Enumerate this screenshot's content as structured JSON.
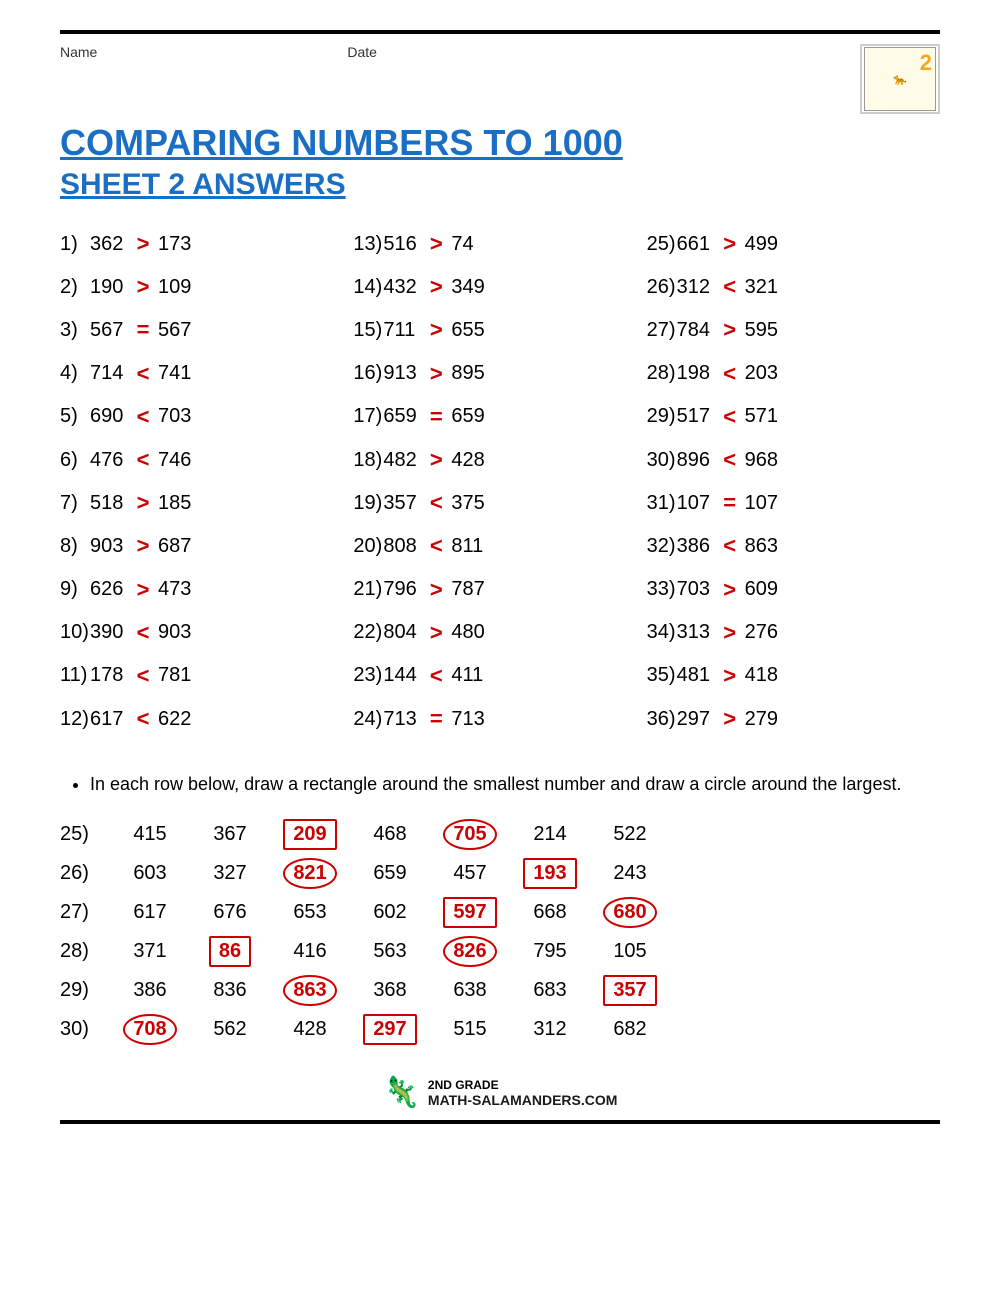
{
  "header": {
    "name_label": "Name",
    "date_label": "Date",
    "logo_num": "2"
  },
  "title": "COMPARING NUMBERS TO 1000",
  "subtitle": "SHEET 2 ANSWERS",
  "comparisons": {
    "col1": [
      {
        "num": "1)",
        "a": "362",
        "op": ">",
        "b": "173"
      },
      {
        "num": "2)",
        "a": "190",
        "op": ">",
        "b": "109"
      },
      {
        "num": "3)",
        "a": "567",
        "op": "=",
        "b": "567"
      },
      {
        "num": "4)",
        "a": "714",
        "op": "<",
        "b": "741"
      },
      {
        "num": "5)",
        "a": "690",
        "op": "<",
        "b": "703"
      },
      {
        "num": "6)",
        "a": "476",
        "op": "<",
        "b": "746"
      },
      {
        "num": "7)",
        "a": "518",
        "op": ">",
        "b": "185"
      },
      {
        "num": "8)",
        "a": "903",
        "op": ">",
        "b": "687"
      },
      {
        "num": "9)",
        "a": "626",
        "op": ">",
        "b": "473"
      },
      {
        "num": "10)",
        "a": "390",
        "op": "<",
        "b": "903"
      },
      {
        "num": "11)",
        "a": "178",
        "op": "<",
        "b": "781"
      },
      {
        "num": "12)",
        "a": "617",
        "op": "<",
        "b": "622"
      }
    ],
    "col2": [
      {
        "num": "13)",
        "a": "516",
        "op": ">",
        "b": "74"
      },
      {
        "num": "14)",
        "a": "432",
        "op": ">",
        "b": "349"
      },
      {
        "num": "15)",
        "a": "711",
        "op": ">",
        "b": "655"
      },
      {
        "num": "16)",
        "a": "913",
        "op": ">",
        "b": "895"
      },
      {
        "num": "17)",
        "a": "659",
        "op": "=",
        "b": "659"
      },
      {
        "num": "18)",
        "a": "482",
        "op": ">",
        "b": "428"
      },
      {
        "num": "19)",
        "a": "357",
        "op": "<",
        "b": "375"
      },
      {
        "num": "20)",
        "a": "808",
        "op": "<",
        "b": "811"
      },
      {
        "num": "21)",
        "a": "796",
        "op": ">",
        "b": "787"
      },
      {
        "num": "22)",
        "a": "804",
        "op": ">",
        "b": "480"
      },
      {
        "num": "23)",
        "a": "144",
        "op": "<",
        "b": "411"
      },
      {
        "num": "24)",
        "a": "713",
        "op": "=",
        "b": "713"
      }
    ],
    "col3": [
      {
        "num": "25)",
        "a": "661",
        "op": ">",
        "b": "499"
      },
      {
        "num": "26)",
        "a": "312",
        "op": "<",
        "b": "321"
      },
      {
        "num": "27)",
        "a": "784",
        "op": ">",
        "b": "595"
      },
      {
        "num": "28)",
        "a": "198",
        "op": "<",
        "b": "203"
      },
      {
        "num": "29)",
        "a": "517",
        "op": "<",
        "b": "571"
      },
      {
        "num": "30)",
        "a": "896",
        "op": "<",
        "b": "968"
      },
      {
        "num": "31)",
        "a": "107",
        "op": "=",
        "b": "107"
      },
      {
        "num": "32)",
        "a": "386",
        "op": "<",
        "b": "863"
      },
      {
        "num": "33)",
        "a": "703",
        "op": ">",
        "b": "609"
      },
      {
        "num": "34)",
        "a": "313",
        "op": ">",
        "b": "276"
      },
      {
        "num": "35)",
        "a": "481",
        "op": ">",
        "b": "418"
      },
      {
        "num": "36)",
        "a": "297",
        "op": ">",
        "b": "279"
      }
    ]
  },
  "bullet_text": "In each row below, draw a rectangle around the smallest number and draw a circle around the largest.",
  "number_rows": [
    {
      "label": "25)",
      "cells": [
        {
          "val": "415",
          "type": "plain"
        },
        {
          "val": "367",
          "type": "plain"
        },
        {
          "val": "209",
          "type": "rect"
        },
        {
          "val": "468",
          "type": "plain"
        },
        {
          "val": "705",
          "type": "circle"
        },
        {
          "val": "214",
          "type": "plain"
        },
        {
          "val": "522",
          "type": "plain"
        }
      ]
    },
    {
      "label": "26)",
      "cells": [
        {
          "val": "603",
          "type": "plain"
        },
        {
          "val": "327",
          "type": "plain"
        },
        {
          "val": "821",
          "type": "circle"
        },
        {
          "val": "659",
          "type": "plain"
        },
        {
          "val": "457",
          "type": "plain"
        },
        {
          "val": "193",
          "type": "rect"
        },
        {
          "val": "243",
          "type": "plain"
        }
      ]
    },
    {
      "label": "27)",
      "cells": [
        {
          "val": "617",
          "type": "plain"
        },
        {
          "val": "676",
          "type": "plain"
        },
        {
          "val": "653",
          "type": "plain"
        },
        {
          "val": "602",
          "type": "plain"
        },
        {
          "val": "597",
          "type": "rect"
        },
        {
          "val": "668",
          "type": "plain"
        },
        {
          "val": "680",
          "type": "circle"
        }
      ]
    },
    {
      "label": "28)",
      "cells": [
        {
          "val": "371",
          "type": "plain"
        },
        {
          "val": "86",
          "type": "rect"
        },
        {
          "val": "416",
          "type": "plain"
        },
        {
          "val": "563",
          "type": "plain"
        },
        {
          "val": "826",
          "type": "circle"
        },
        {
          "val": "795",
          "type": "plain"
        },
        {
          "val": "105",
          "type": "plain"
        }
      ]
    },
    {
      "label": "29)",
      "cells": [
        {
          "val": "386",
          "type": "plain"
        },
        {
          "val": "836",
          "type": "plain"
        },
        {
          "val": "863",
          "type": "circle"
        },
        {
          "val": "368",
          "type": "plain"
        },
        {
          "val": "638",
          "type": "plain"
        },
        {
          "val": "683",
          "type": "plain"
        },
        {
          "val": "357",
          "type": "rect"
        }
      ]
    },
    {
      "label": "30)",
      "cells": [
        {
          "val": "708",
          "type": "circle"
        },
        {
          "val": "562",
          "type": "plain"
        },
        {
          "val": "428",
          "type": "plain"
        },
        {
          "val": "297",
          "type": "rect"
        },
        {
          "val": "515",
          "type": "plain"
        },
        {
          "val": "312",
          "type": "plain"
        },
        {
          "val": "682",
          "type": "plain"
        }
      ]
    }
  ],
  "footer": {
    "grade": "2ND GRADE",
    "site": "MATH-SALAMANDERS.COM"
  }
}
